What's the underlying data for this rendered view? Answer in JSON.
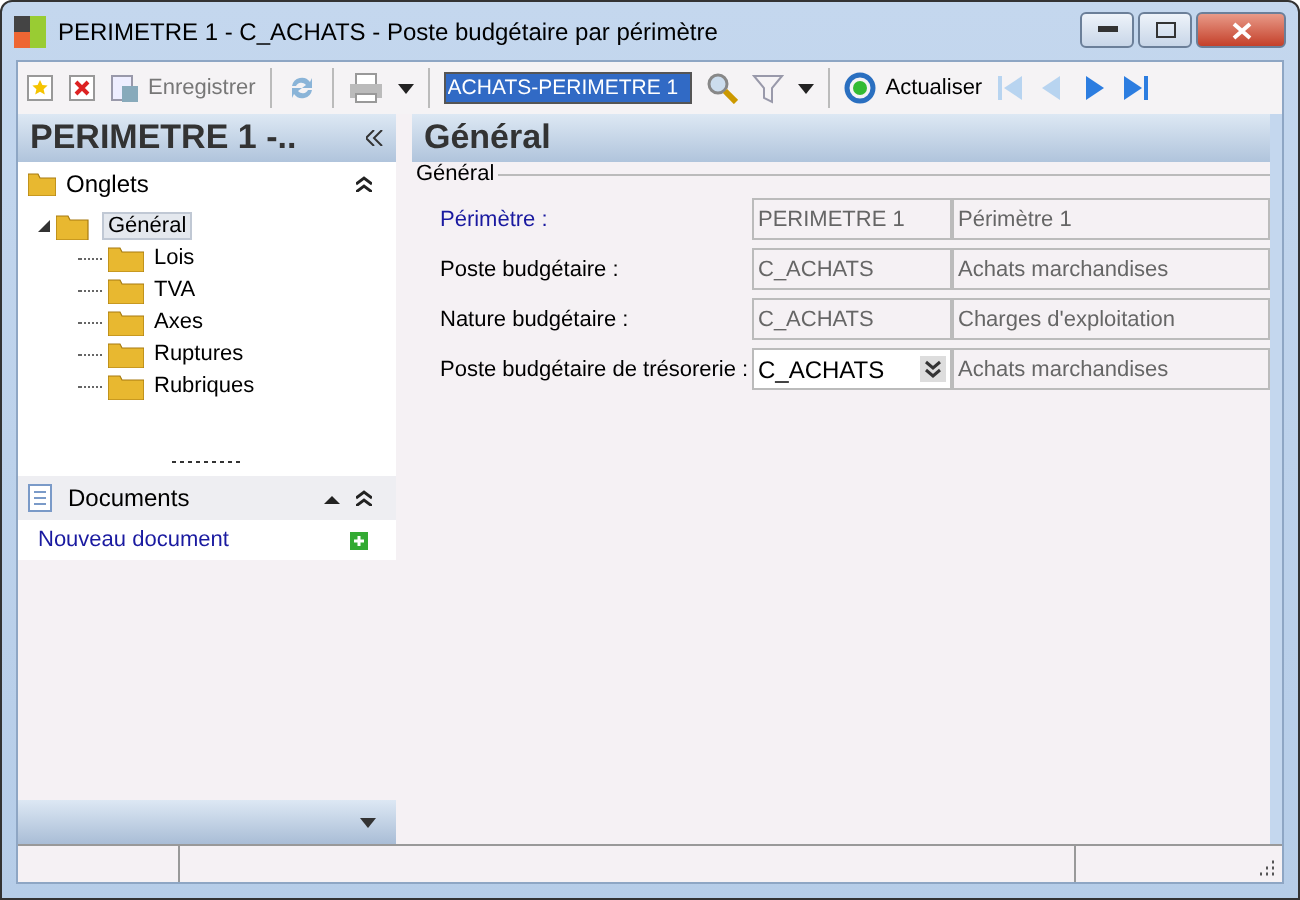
{
  "window": {
    "title": "PERIMETRE 1 - C_ACHATS -  Poste budgétaire par périmètre"
  },
  "toolbar": {
    "save_label": "Enregistrer",
    "search_value": "ACHATS-PERIMETRE 1",
    "refresh_label": "Actualiser"
  },
  "sidebar": {
    "title": "PERIMETRE 1 -..",
    "tabs_header": "Onglets",
    "tree": [
      {
        "label": "Général",
        "selected": true,
        "expanded": true,
        "children": [
          {
            "label": "Lois",
            "selected": false
          },
          {
            "label": "TVA",
            "selected": false
          },
          {
            "label": "Axes",
            "selected": false
          },
          {
            "label": "Ruptures",
            "selected": false
          },
          {
            "label": "Rubriques",
            "selected": false
          }
        ]
      }
    ],
    "documents_header": "Documents",
    "documents_link": "Nouveau document"
  },
  "main": {
    "title": "Général",
    "group": "Général",
    "fields": [
      {
        "kind": "link",
        "label": "Périmètre :",
        "code": "PERIMETRE 1",
        "description": "Périmètre 1",
        "editable": false
      },
      {
        "kind": "text",
        "label": "Poste budgétaire :",
        "code": "C_ACHATS",
        "description": "Achats marchandises",
        "editable": false
      },
      {
        "kind": "text",
        "label": "Nature budgétaire :",
        "code": "C_ACHATS",
        "description": "Charges d'exploitation",
        "editable": false
      },
      {
        "kind": "text",
        "label": "Poste budgétaire de trésorerie :",
        "code": "C_ACHATS",
        "description": "Achats marchandises",
        "editable": true
      }
    ]
  }
}
